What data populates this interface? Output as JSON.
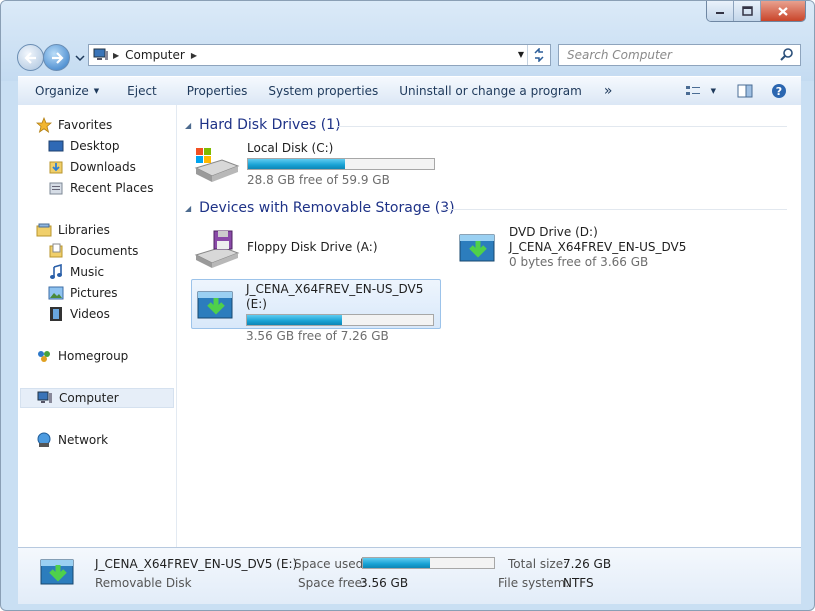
{
  "address": {
    "crumb": "Computer"
  },
  "search": {
    "placeholder": "Search Computer"
  },
  "toolbar": {
    "organize": "Organize",
    "eject": "Eject",
    "properties": "Properties",
    "system_properties": "System properties",
    "uninstall": "Uninstall or change a program",
    "more": "»"
  },
  "sidebar": {
    "favorites": "Favorites",
    "desktop": "Desktop",
    "downloads": "Downloads",
    "recent": "Recent Places",
    "libraries": "Libraries",
    "documents": "Documents",
    "music": "Music",
    "pictures": "Pictures",
    "videos": "Videos",
    "homegroup": "Homegroup",
    "computer": "Computer",
    "network": "Network"
  },
  "groups": {
    "hdd": "Hard Disk Drives (1)",
    "removable": "Devices with Removable Storage (3)"
  },
  "drives": {
    "c": {
      "name": "Local Disk (C:)",
      "free": "28.8 GB free of 59.9 GB",
      "used_fraction": 0.52
    },
    "a": {
      "name": "Floppy Disk Drive (A:)"
    },
    "d": {
      "name": "DVD Drive (D:)",
      "label": "J_CENA_X64FREV_EN-US_DV5",
      "free": "0 bytes free of 3.66 GB"
    },
    "e": {
      "name": "J_CENA_X64FREV_EN-US_DV5 (E:)",
      "free": "3.56 GB free of 7.26 GB",
      "used_fraction": 0.51
    }
  },
  "details": {
    "title": "J_CENA_X64FREV_EN-US_DV5 (E:)",
    "type": "Removable Disk",
    "space_used_label": "Space used:",
    "space_used_fraction": 0.51,
    "space_free_label": "Space free:",
    "space_free": "3.56 GB",
    "total_size_label": "Total size:",
    "total_size": "7.26 GB",
    "fs_label": "File system:",
    "fs": "NTFS"
  }
}
